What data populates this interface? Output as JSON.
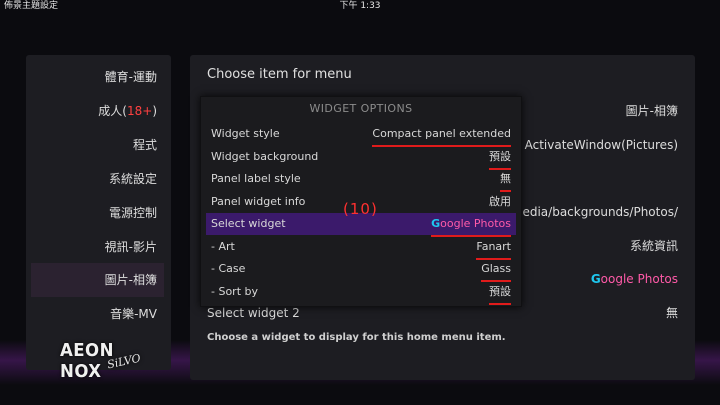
{
  "topbar": {
    "window_title": "佈景主題設定",
    "clock": "下午 1:33"
  },
  "left_menu": {
    "items": [
      {
        "label": "體育-運動"
      },
      {
        "label_pre": "成人(",
        "label_red": "18+",
        "label_post": ")"
      },
      {
        "label": "程式"
      },
      {
        "label": "系統設定"
      },
      {
        "label": "電源控制"
      },
      {
        "label": "視訊-影片"
      },
      {
        "label": "圖片-相簿",
        "active": true
      },
      {
        "label": "音樂-MV"
      }
    ]
  },
  "logo": {
    "main": "AEON NOX",
    "sub": "SiLVO"
  },
  "main_panel": {
    "title": "Choose item for menu",
    "right_values": {
      "item_label": "圖片-相簿",
      "action": "ActivateWindow(Pictures)",
      "background_path": "edia/backgrounds/Photos/",
      "info": "系統資訊",
      "widget_g": "G",
      "widget_rest": "oogle Photos"
    },
    "select_widget_2_label": "Select widget 2",
    "select_widget_2_value": "無",
    "description": "Choose a widget to display for this home menu item."
  },
  "dialog": {
    "title": "WIDGET OPTIONS",
    "rows": [
      {
        "label": "Widget style",
        "value": "Compact panel extended"
      },
      {
        "label": "Widget background",
        "value": "預設"
      },
      {
        "label": "Panel label style",
        "value": "無"
      },
      {
        "label": "Panel widget info",
        "value": "啟用"
      },
      {
        "label": "Select widget",
        "value_g": "G",
        "value_rest": "oogle Photos",
        "selected": true
      },
      {
        "label": " - Art",
        "value": "Fanart"
      },
      {
        "label": " - Case",
        "value": "Glass"
      },
      {
        "label": " - Sort by",
        "value": "預設"
      }
    ]
  },
  "annotation": "(10)",
  "colors": {
    "highlight": "#3b1a6b",
    "underline": "#e01b1b",
    "google_g": "#1ec8f0",
    "google_rest": "#ff5aa8"
  }
}
